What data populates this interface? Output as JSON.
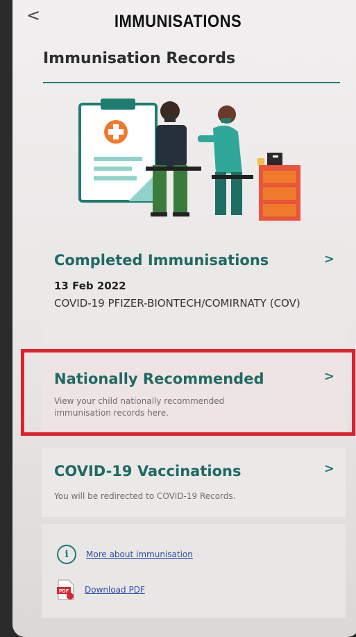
{
  "header": {
    "back_glyph": "<",
    "title": "IMMUNISATIONS"
  },
  "section_title": "Immunisation Records",
  "cards": {
    "completed": {
      "title": "Completed Immunisations",
      "date": "13 Feb 2022",
      "description": "COVID-19 PFIZER-BIONTECH/COMIRNATY (COV)"
    },
    "national": {
      "title": "Nationally Recommended",
      "description": "View your child nationally recommended immunisation records here."
    },
    "covid": {
      "title": "COVID-19 Vaccinations",
      "description": "You will be redirected to COVID-19 Records."
    }
  },
  "links": {
    "more": "More about immunisation",
    "pdf": "Download PDF",
    "pdf_icon_text": "PDF"
  },
  "icons": {
    "chevron": ">",
    "info": "i"
  },
  "colors": {
    "accent": "#1e6a62",
    "highlight": "#e32028",
    "link": "#2a4fa8"
  }
}
